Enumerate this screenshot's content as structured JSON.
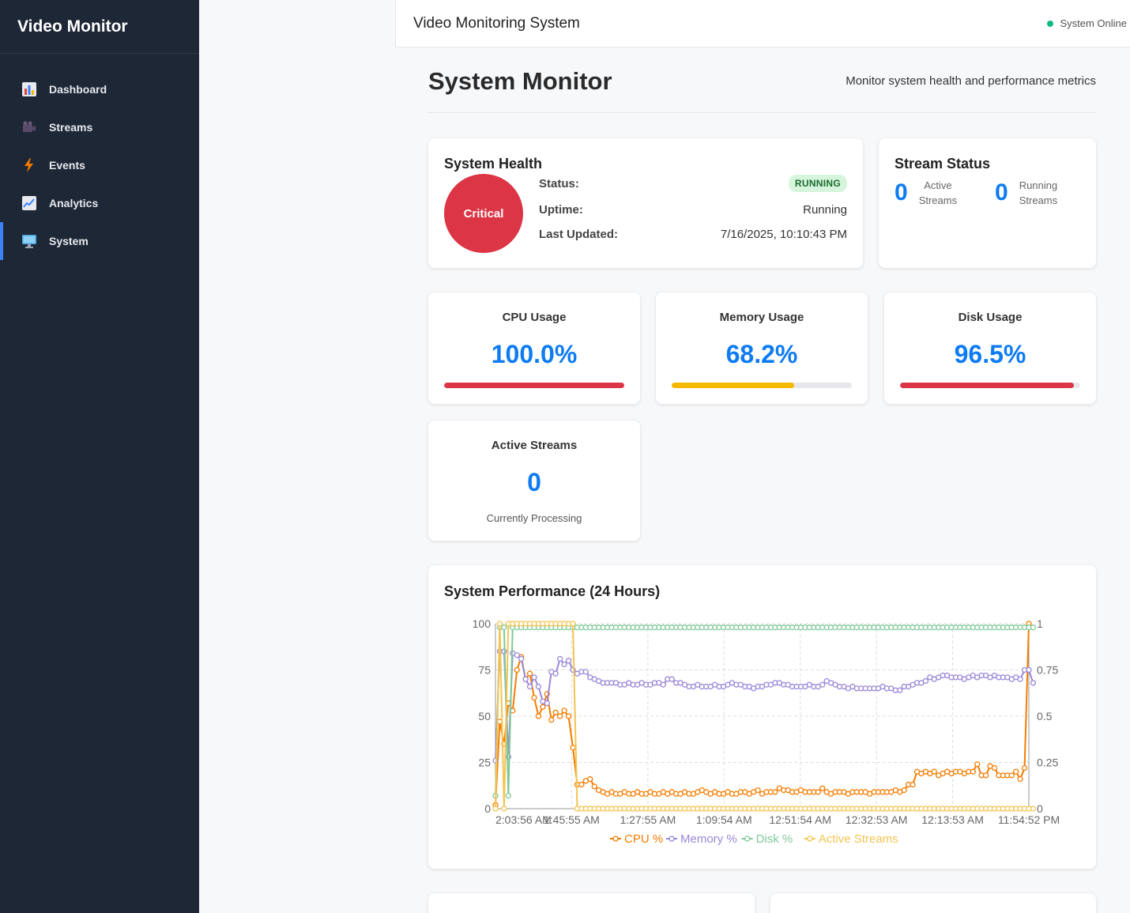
{
  "sidebar": {
    "brand": "Video Monitor",
    "items": [
      {
        "label": "Dashboard",
        "icon": "bar-chart-icon"
      },
      {
        "label": "Streams",
        "icon": "video-camera-icon"
      },
      {
        "label": "Events",
        "icon": "lightning-icon"
      },
      {
        "label": "Analytics",
        "icon": "line-chart-icon"
      },
      {
        "label": "System",
        "icon": "monitor-icon",
        "active": true
      }
    ]
  },
  "topbar": {
    "title": "Video Monitoring System",
    "status": "System Online",
    "status_color": "#10b981"
  },
  "page": {
    "title": "System Monitor",
    "subtitle": "Monitor system health and performance metrics"
  },
  "health": {
    "title": "System Health",
    "indicator": "Critical",
    "indicator_color": "#dc3545",
    "status_label": "Status:",
    "status_value": "RUNNING",
    "uptime_label": "Uptime:",
    "uptime_value": "Running",
    "updated_label": "Last Updated:",
    "updated_value": "7/16/2025, 10:10:43 PM"
  },
  "stream_status": {
    "title": "Stream Status",
    "active_count": "0",
    "active_label_1": "Active",
    "active_label_2": "Streams",
    "running_count": "0",
    "running_label_1": "Running",
    "running_label_2": "Streams"
  },
  "metrics": {
    "cpu": {
      "label": "CPU Usage",
      "value": "100.0%",
      "level": 100,
      "color": "#dc3545"
    },
    "memory": {
      "label": "Memory Usage",
      "value": "68.2%",
      "level": 68.2,
      "color": "#f5b800"
    },
    "disk": {
      "label": "Disk Usage",
      "value": "96.5%",
      "level": 96.5,
      "color": "#dc3545"
    },
    "streams": {
      "label": "Active Streams",
      "value": "0",
      "sub": "Currently Processing"
    }
  },
  "chart_data": {
    "type": "line",
    "title": "System Performance (24 Hours)",
    "x_tick_labels": [
      "2:03:56 AM",
      "1:45:55 AM",
      "1:27:55 AM",
      "1:09:54 AM",
      "12:51:54 AM",
      "12:32:53 AM",
      "12:13:53 AM",
      "11:54:52 PM"
    ],
    "y_left_ticks": [
      "0",
      "25",
      "50",
      "75",
      "100"
    ],
    "y_right_ticks": [
      "0",
      "0.25",
      "0.5",
      "0.75",
      "1"
    ],
    "ylim_left": [
      0,
      100
    ],
    "ylim_right": [
      0,
      1
    ],
    "grid": true,
    "legend_position": "bottom",
    "series": [
      {
        "name": "CPU %",
        "color": "#f57c00",
        "axis": "left",
        "values": [
          2,
          47,
          35,
          57,
          53,
          75,
          82,
          70,
          73,
          60,
          50,
          55,
          62,
          48,
          52,
          50,
          53,
          50,
          33,
          13,
          13,
          15,
          16,
          12,
          10,
          9,
          8,
          9,
          8,
          8,
          9,
          8,
          8,
          9,
          8,
          8,
          9,
          8,
          8,
          9,
          8,
          9,
          8,
          8,
          9,
          8,
          8,
          9,
          10,
          9,
          8,
          9,
          8,
          8,
          9,
          8,
          8,
          9,
          9,
          8,
          9,
          10,
          8,
          9,
          9,
          9,
          11,
          10,
          10,
          9,
          9,
          10,
          9,
          9,
          9,
          9,
          11,
          9,
          8,
          9,
          9,
          9,
          8,
          9,
          9,
          9,
          9,
          8,
          9,
          9,
          9,
          9,
          9,
          10,
          9,
          10,
          13,
          13,
          20,
          19,
          20,
          19,
          20,
          18,
          19,
          20,
          19,
          20,
          20,
          19,
          20,
          20,
          24,
          18,
          18,
          23,
          22,
          18,
          18,
          18,
          18,
          20,
          16,
          22,
          100
        ]
      },
      {
        "name": "Memory %",
        "color": "#9b87d9",
        "axis": "left",
        "values": [
          26,
          85,
          85,
          28,
          84,
          83,
          81,
          70,
          66,
          71,
          66,
          58,
          57,
          74,
          73,
          81,
          78,
          80,
          75,
          73,
          74,
          74,
          71,
          70,
          69,
          68,
          68,
          68,
          68,
          67,
          67,
          68,
          67,
          67,
          68,
          67,
          67,
          68,
          68,
          67,
          70,
          70,
          68,
          68,
          67,
          66,
          66,
          67,
          66,
          66,
          66,
          67,
          66,
          66,
          67,
          68,
          67,
          67,
          66,
          66,
          65,
          66,
          66,
          67,
          67,
          68,
          68,
          67,
          67,
          66,
          66,
          66,
          66,
          67,
          66,
          66,
          67,
          69,
          68,
          67,
          66,
          66,
          65,
          66,
          65,
          65,
          65,
          65,
          65,
          65,
          66,
          65,
          65,
          64,
          64,
          66,
          66,
          67,
          68,
          68,
          69,
          71,
          70,
          71,
          72,
          72,
          71,
          71,
          71,
          70,
          71,
          72,
          71,
          72,
          72,
          71,
          72,
          71,
          71,
          71,
          70,
          71,
          70,
          75,
          75,
          68
        ]
      },
      {
        "name": "Disk %",
        "color": "#7fc999",
        "axis": "left",
        "values": [
          7,
          98,
          98,
          7,
          98,
          98,
          98,
          98,
          98,
          98,
          98,
          98,
          98,
          98,
          98,
          98,
          98,
          98,
          98,
          98,
          98,
          98,
          98,
          98,
          98,
          98,
          98,
          98,
          98,
          98,
          98,
          98,
          98,
          98,
          98,
          98,
          98,
          98,
          98,
          98,
          98,
          98,
          98,
          98,
          98,
          98,
          98,
          98,
          98,
          98,
          98,
          98,
          98,
          98,
          98,
          98,
          98,
          98,
          98,
          98,
          98,
          98,
          98,
          98,
          98,
          98,
          98,
          98,
          98,
          98,
          98,
          98,
          98,
          98,
          98,
          98,
          98,
          98,
          98,
          98,
          98,
          98,
          98,
          98,
          98,
          98,
          98,
          98,
          98,
          98,
          98,
          98,
          98,
          98,
          98,
          98,
          98,
          98,
          98,
          98,
          98,
          98,
          98,
          98,
          98,
          98,
          98,
          98,
          98,
          98,
          98,
          98,
          98,
          98,
          98,
          98,
          98,
          98,
          98,
          98,
          98,
          98,
          98,
          98,
          98,
          98
        ]
      },
      {
        "name": "Active Streams",
        "color": "#f5c451",
        "axis": "right",
        "values": [
          0,
          1,
          0,
          1,
          1,
          1,
          1,
          1,
          1,
          1,
          1,
          1,
          1,
          1,
          1,
          1,
          1,
          1,
          1,
          0,
          0,
          0,
          0,
          0,
          0,
          0,
          0,
          0,
          0,
          0,
          0,
          0,
          0,
          0,
          0,
          0,
          0,
          0,
          0,
          0,
          0,
          0,
          0,
          0,
          0,
          0,
          0,
          0,
          0,
          0,
          0,
          0,
          0,
          0,
          0,
          0,
          0,
          0,
          0,
          0,
          0,
          0,
          0,
          0,
          0,
          0,
          0,
          0,
          0,
          0,
          0,
          0,
          0,
          0,
          0,
          0,
          0,
          0,
          0,
          0,
          0,
          0,
          0,
          0,
          0,
          0,
          0,
          0,
          0,
          0,
          0,
          0,
          0,
          0,
          0,
          0,
          0,
          0,
          0,
          0,
          0,
          0,
          0,
          0,
          0,
          0,
          0,
          0,
          0,
          0,
          0,
          0,
          0,
          0,
          0,
          0,
          0,
          0,
          0,
          0,
          0,
          0,
          0,
          0,
          0,
          0
        ]
      }
    ]
  }
}
